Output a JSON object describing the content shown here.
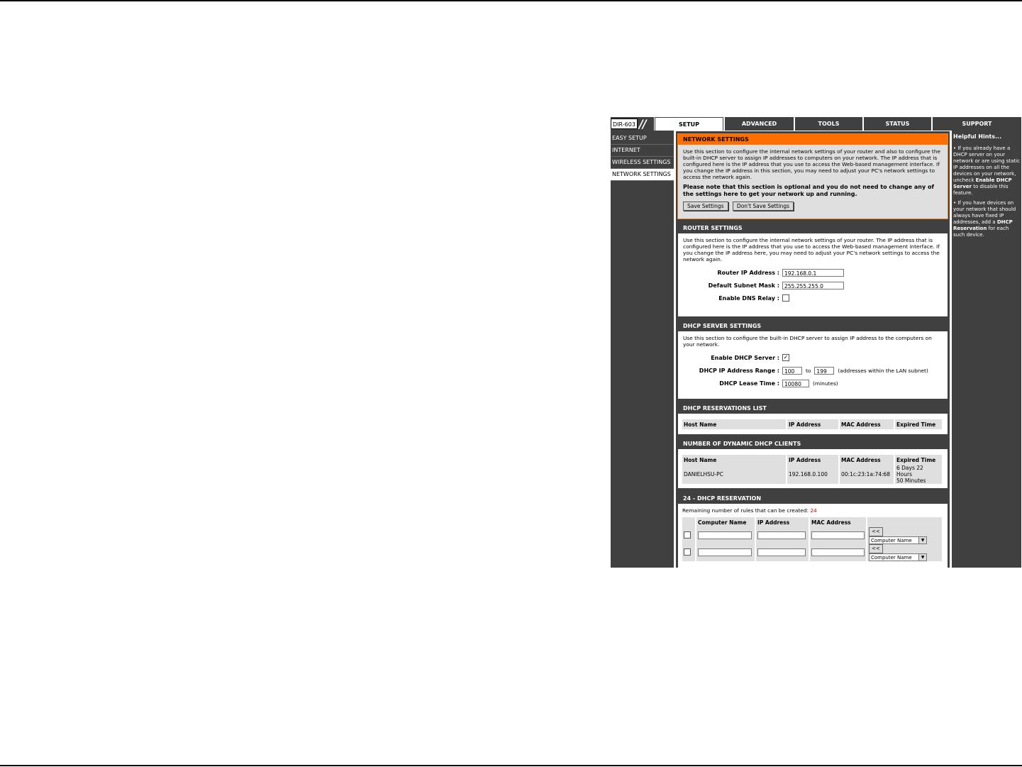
{
  "header": {
    "model": "DIR-603",
    "tabs": [
      "SETUP",
      "ADVANCED",
      "TOOLS",
      "STATUS",
      "SUPPORT"
    ]
  },
  "sidebar": {
    "items": [
      {
        "label": "EASY SETUP"
      },
      {
        "label": "INTERNET"
      },
      {
        "label": "WIRELESS SETTINGS"
      },
      {
        "label": "NETWORK SETTINGS"
      }
    ]
  },
  "network": {
    "title": "NETWORK SETTINGS",
    "desc": "Use this section to configure the internal network settings of your router and also to configure the built-in DHCP server to assign IP addresses to computers on your network. The IP address that is configured here is the IP address that you use to access the Web-based management interface. If you change the IP address in this section, you may need to adjust your PC's network settings to access the network again.",
    "note": "Please note that this section is optional and you do not need to change any of the settings here to get your network up and running.",
    "save_label": "Save Settings",
    "dont_save_label": "Don't Save Settings"
  },
  "router": {
    "title": "ROUTER SETTINGS",
    "desc": "Use this section to configure the internal network settings of your router. The IP address that is configured here is the IP address that you use to access the Web-based management interface. If you change the IP address here, you may need to adjust your PC's network settings to access the network again.",
    "ip_label": "Router IP Address :",
    "ip_value": "192.168.0.1",
    "mask_label": "Default Subnet Mask :",
    "mask_value": "255.255.255.0",
    "dns_label": "Enable DNS Relay :"
  },
  "dhcp": {
    "title": "DHCP SERVER SETTINGS",
    "desc": "Use this section to configure the built-in DHCP server to assign IP address to the computers on your network.",
    "enable_label": "Enable DHCP Server :",
    "range_label": "DHCP IP Address Range :",
    "range_start": "100",
    "range_to": "to",
    "range_end": "199",
    "range_note": "(addresses within the LAN subnet)",
    "lease_label": "DHCP Lease Time :",
    "lease_value": "10080",
    "lease_unit": "(minutes)"
  },
  "reservations_list": {
    "title": "DHCP RESERVATIONS LIST",
    "columns": [
      "Host Name",
      "IP Address",
      "MAC Address",
      "Expired Time"
    ]
  },
  "clients": {
    "title": "NUMBER OF DYNAMIC DHCP CLIENTS",
    "columns": [
      "Host Name",
      "IP Address",
      "MAC Address",
      "Expired Time"
    ],
    "rows": [
      {
        "host": "DANIELHSU-PC",
        "ip": "192.168.0.100",
        "mac": "00:1c:23:1a:74:68",
        "expired1": "6 Days 22 Hours",
        "expired2": "50 Minutes"
      }
    ]
  },
  "reservation": {
    "title": "24 - DHCP RESERVATION",
    "remaining_label": "Remaining number of rules that can be created:",
    "remaining_count": "24",
    "columns": [
      "Computer Name",
      "IP Address",
      "MAC Address"
    ],
    "copy_label": "<<",
    "select_value": "Computer Name"
  },
  "hints": {
    "title": "Helpful Hints...",
    "hint1_pre": "If you already have a DHCP server on your network or are using static IP addresses on all the devices on your network, uncheck",
    "hint1_bold": "Enable DHCP Server",
    "hint1_post": "to disable this feature.",
    "hint2_pre": "If you have devices on your network that should always have fixed IP addresses, add a",
    "hint2_bold": "DHCP Reservation",
    "hint2_post": "for each such device."
  }
}
